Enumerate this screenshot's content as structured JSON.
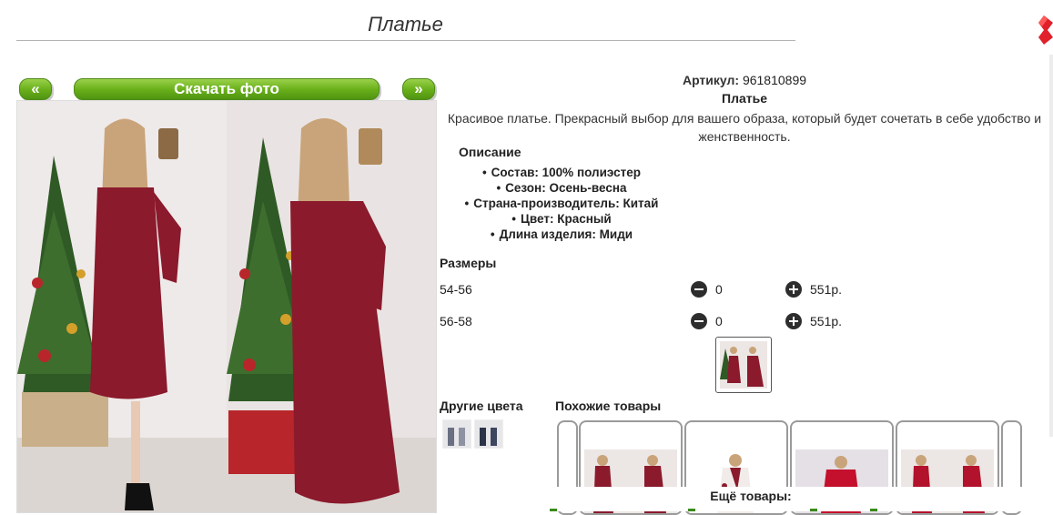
{
  "page": {
    "title": "Платье"
  },
  "nav": {
    "prev_label": "«",
    "download_label": "Скачать фото",
    "next_label": "»"
  },
  "product": {
    "article_label": "Артикул:",
    "article_value": "961810899",
    "name": "Платье",
    "description": "Красивое платье. Прекрасный выбор для вашего образа, который будет сочетать в себе удобство и женственность.",
    "props_heading": "Описание",
    "props": [
      "Состав: 100% полиэстер",
      "Сезон: Осень-весна",
      "Страна-производитель: Китай",
      "Цвет: Красный",
      "Длина изделия: Миди"
    ]
  },
  "sizes": {
    "heading": "Размеры",
    "rows": [
      {
        "size": "54-56",
        "qty": "0",
        "price": "551р."
      },
      {
        "size": "56-58",
        "qty": "0",
        "price": "551р."
      }
    ]
  },
  "other_colors": {
    "heading": "Другие цвета"
  },
  "similar": {
    "heading": "Похожие товары"
  },
  "more": {
    "label": "Ещё товары:"
  },
  "colors": {
    "accent_green": "#6bb11c",
    "close_red": "#e0202a",
    "dress": "#8a1a2c"
  },
  "icons": [
    "close-icon",
    "minus-icon",
    "plus-icon"
  ]
}
